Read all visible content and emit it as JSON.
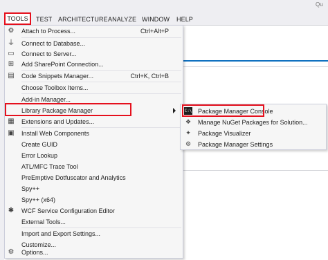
{
  "menubar": {
    "items": [
      {
        "label": "TOOLS"
      },
      {
        "label": "TEST"
      },
      {
        "label": "ARCHITECTURE"
      },
      {
        "label": "ANALYZE"
      },
      {
        "label": "WINDOW"
      },
      {
        "label": "HELP"
      }
    ],
    "quick_launch": "Qu"
  },
  "tools_menu": {
    "items": [
      {
        "label": "Attach to Process...",
        "shortcut": "Ctrl+Alt+P",
        "icon": "attach-process-icon"
      },
      {
        "label": "Connect to Database...",
        "icon": "database-plug-icon"
      },
      {
        "label": "Connect to Server...",
        "icon": "server-icon"
      },
      {
        "label": "Add SharePoint Connection...",
        "icon": "sharepoint-icon"
      },
      {
        "label": "Code Snippets Manager...",
        "shortcut": "Ctrl+K, Ctrl+B",
        "icon": "code-snippets-icon"
      },
      {
        "label": "Choose Toolbox Items..."
      },
      {
        "label": "Add-in Manager..."
      },
      {
        "label": "Library Package Manager",
        "has_submenu": true
      },
      {
        "label": "Extensions and Updates...",
        "icon": "extensions-icon"
      },
      {
        "label": "Install Web Components",
        "icon": "web-components-icon"
      },
      {
        "label": "Create GUID"
      },
      {
        "label": "Error Lookup"
      },
      {
        "label": "ATL/MFC Trace Tool"
      },
      {
        "label": "PreEmptive Dotfuscator and Analytics"
      },
      {
        "label": "Spy++"
      },
      {
        "label": "Spy++ (x64)"
      },
      {
        "label": "WCF Service Configuration Editor",
        "icon": "wcf-gear-icon"
      },
      {
        "label": "External Tools..."
      },
      {
        "label": "Import and Export Settings..."
      },
      {
        "label": "Customize..."
      },
      {
        "label": "Options...",
        "icon": "options-gear-icon"
      }
    ]
  },
  "submenu": {
    "items": [
      {
        "label": "Package Manager Console",
        "icon": "console-icon"
      },
      {
        "label": "Manage NuGet Packages for Solution...",
        "icon": "nuget-packages-icon"
      },
      {
        "label": "Package Visualizer",
        "icon": "package-visualizer-icon"
      },
      {
        "label": "Package Manager Settings",
        "icon": "settings-gear-icon"
      }
    ]
  },
  "colors": {
    "highlight_red": "#e5101d",
    "menu_background": "#f6f6f6",
    "menubar_background": "#eeeef2",
    "accent_blue": "#0e70c0"
  }
}
